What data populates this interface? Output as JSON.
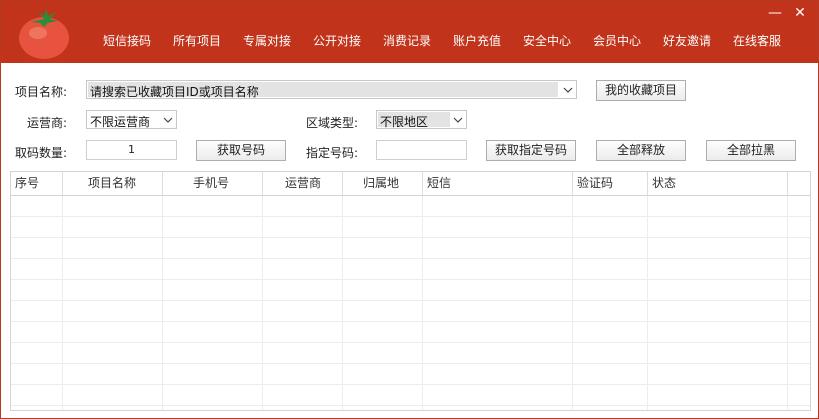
{
  "colors": {
    "titlebar": "#c1331a",
    "logo": "tomato"
  },
  "nav": {
    "items": [
      "短信接码",
      "所有项目",
      "专属对接",
      "公开对接",
      "消费记录",
      "账户充值",
      "安全中心",
      "会员中心",
      "好友邀请",
      "在线客服"
    ]
  },
  "window": {
    "minimize": "—",
    "close": "✕"
  },
  "form": {
    "project_label": "项目名称:",
    "project_value": "请搜索已收藏项目ID或项目名称",
    "favorites_button": "我的收藏项目",
    "carrier_label": "运营商:",
    "carrier_value": "不限运营商",
    "region_label": "区域类型:",
    "region_value": "不限地区",
    "count_label": "取码数量:",
    "count_value": "1",
    "get_number_button": "获取号码",
    "specific_label": "指定号码:",
    "specific_value": "",
    "get_specific_button": "获取指定号码",
    "release_all_button": "全部释放",
    "blacklist_all_button": "全部拉黑"
  },
  "table": {
    "headers": [
      "序号",
      "项目名称",
      "手机号",
      "运营商",
      "归属地",
      "短信",
      "验证码",
      "状态"
    ],
    "rows": []
  }
}
